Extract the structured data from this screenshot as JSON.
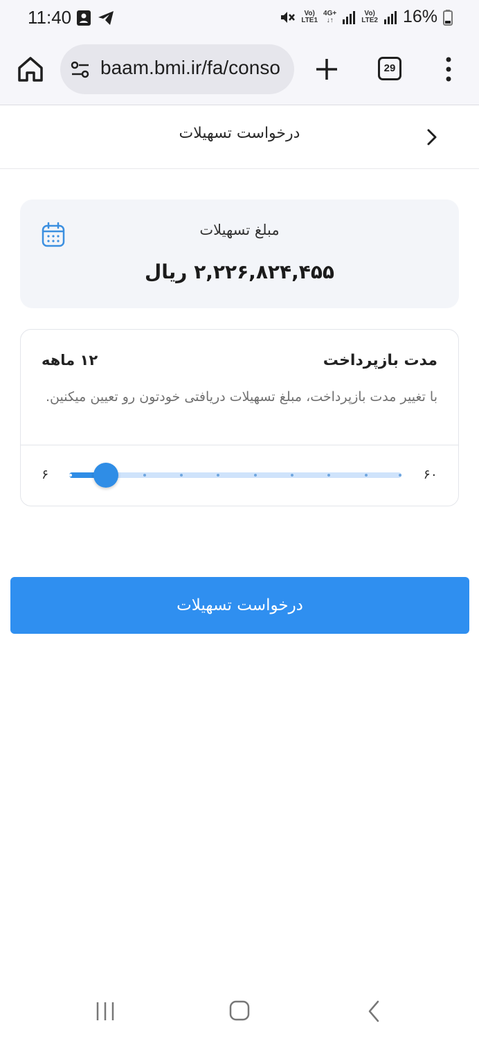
{
  "status_bar": {
    "time": "11:40",
    "net1_top": "Vo)",
    "net1_bottom": "LTE1",
    "net2_top": "4G+",
    "net3_top": "Vo)",
    "net3_bottom": "LTE2",
    "battery": "16%"
  },
  "browser": {
    "url": "baam.bmi.ir/fa/conso",
    "tab_count": "29"
  },
  "header": {
    "title": "درخواست تسهیلات"
  },
  "amount_card": {
    "label": "مبلغ تسهیلات",
    "value": "۲,۲۲۶,۸۲۴,۴۵۵ ریال"
  },
  "duration_card": {
    "title": "مدت بازپرداخت",
    "value": "۱۲ ماهه",
    "description": "با تغییر مدت بازپرداخت، مبلغ تسهیلات دریافتی خودتون رو تعیین میکنین.",
    "slider": {
      "min_label": "۶",
      "max_label": "۶۰",
      "min": 6,
      "max": 60,
      "value": 12,
      "steps": 10
    }
  },
  "submit_button": {
    "label": "درخواست تسهیلات"
  },
  "colors": {
    "accent": "#2f8ff0",
    "track": "#cfe3fb"
  }
}
